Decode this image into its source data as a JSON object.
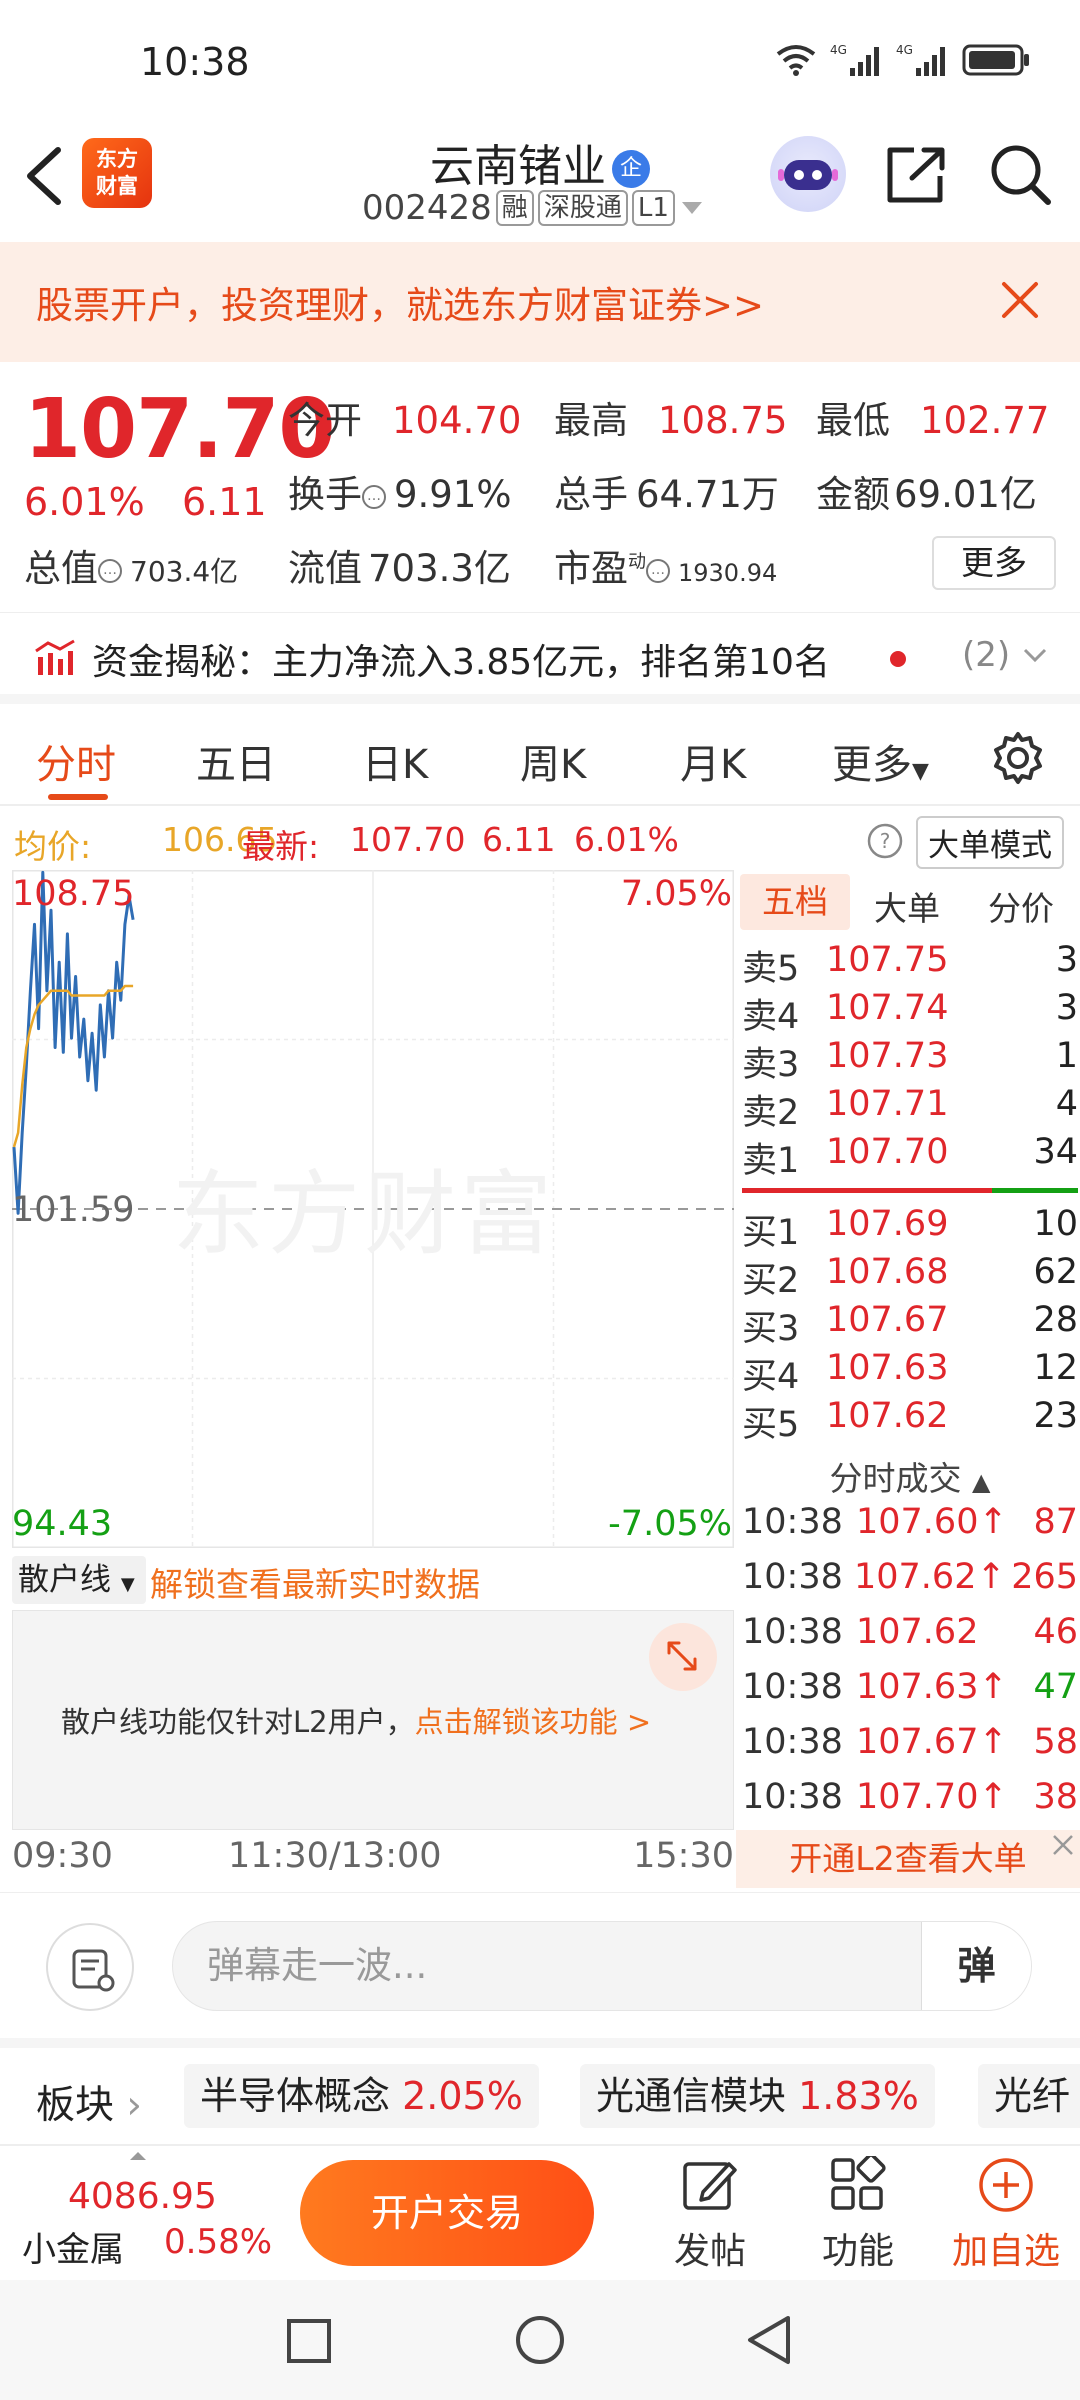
{
  "status": {
    "time": "10:38"
  },
  "header": {
    "logo_text": "东方\n财富",
    "stock_name": "云南锗业",
    "ent_badge": "企",
    "stock_code": "002428",
    "tags": [
      "融",
      "深股通",
      "L1"
    ]
  },
  "banner": {
    "text": "股票开户，投资理财，就选东方财富证券>>"
  },
  "quote": {
    "price": "107.70",
    "change_pct": "6.01%",
    "change": "6.11",
    "open_label": "今开",
    "open": "104.70",
    "high_label": "最高",
    "high": "108.75",
    "low_label": "最低",
    "low": "102.77",
    "turnover_label": "换手",
    "turnover": "9.91%",
    "volume_label": "总手",
    "volume": "64.71万",
    "amount_label": "金额",
    "amount": "69.01亿",
    "mktcap_label": "总值",
    "mktcap": "703.4亿",
    "float_label": "流值",
    "float": "703.3亿",
    "pe_label": "市盈",
    "pe_sup": "动",
    "pe": "1930.94",
    "more_label": "更多"
  },
  "fund": {
    "text": "资金揭秘：主力净流入3.85亿元，排名第10名",
    "count": "(2)"
  },
  "tabs": [
    "分时",
    "五日",
    "日K",
    "周K",
    "月K",
    "更多"
  ],
  "avg": {
    "avg_label": "均价:",
    "avg_value": "106.65",
    "latest_label": "最新:",
    "latest_value": "107.70",
    "latest_change": "6.11",
    "latest_pct": "6.01%",
    "mode_label": "大单模式"
  },
  "chart": {
    "top_price": "108.75",
    "top_pct": "7.05%",
    "mid_price": "101.59",
    "bottom_price": "94.43",
    "bottom_pct": "-7.05%",
    "watermark": "东方财富",
    "time_start": "09:30",
    "time_mid": "11:30/13:00",
    "time_end": "15:30"
  },
  "chart_data": {
    "type": "line",
    "ylim": [
      94.43,
      108.75
    ],
    "ylabel": "",
    "xlabel": "",
    "series": [
      {
        "values": [
          102.9,
          101.5,
          103.2,
          104.6,
          106.2,
          107.6,
          105.4,
          108.7,
          106.2,
          107.9,
          105.0,
          106.8,
          104.9,
          107.4,
          105.2,
          106.5,
          104.8,
          105.6,
          104.3,
          105.3,
          104.1,
          105.9,
          104.8,
          106.2,
          105.2,
          106.8,
          106.0,
          107.6,
          108.2,
          107.7
        ]
      },
      {
        "values": [
          102.9,
          103.2,
          104.2,
          105.0,
          105.4,
          105.7,
          105.9,
          106.0,
          106.1,
          106.2,
          106.2,
          106.2,
          106.2,
          106.2,
          106.1,
          106.1,
          106.1,
          106.1,
          106.1,
          106.1,
          106.1,
          106.1,
          106.1,
          106.2,
          106.2,
          106.2,
          106.2,
          106.3,
          106.3,
          106.3
        ]
      }
    ]
  },
  "book": {
    "tabs": [
      "五档",
      "大单",
      "分价"
    ],
    "asks": [
      {
        "side": "卖5",
        "price": "107.75",
        "qty": "3"
      },
      {
        "side": "卖4",
        "price": "107.74",
        "qty": "3"
      },
      {
        "side": "卖3",
        "price": "107.73",
        "qty": "1"
      },
      {
        "side": "卖2",
        "price": "107.71",
        "qty": "4"
      },
      {
        "side": "卖1",
        "price": "107.70",
        "qty": "34"
      }
    ],
    "bids": [
      {
        "side": "买1",
        "price": "107.69",
        "qty": "10"
      },
      {
        "side": "买2",
        "price": "107.68",
        "qty": "62"
      },
      {
        "side": "买3",
        "price": "107.67",
        "qty": "28"
      },
      {
        "side": "买4",
        "price": "107.63",
        "qty": "12"
      },
      {
        "side": "买5",
        "price": "107.62",
        "qty": "23"
      }
    ]
  },
  "trades": {
    "title": "分时成交",
    "rows": [
      {
        "time": "10:38",
        "price": "107.60↑",
        "qty": "87",
        "color": "#e0262b"
      },
      {
        "time": "10:38",
        "price": "107.62↑",
        "qty": "265",
        "color": "#e0262b"
      },
      {
        "time": "10:38",
        "price": "107.62",
        "qty": "46",
        "color": "#e0262b"
      },
      {
        "time": "10:38",
        "price": "107.63↑",
        "qty": "47",
        "color": "#14a014"
      },
      {
        "time": "10:38",
        "price": "107.67↑",
        "qty": "58",
        "color": "#e0262b"
      },
      {
        "time": "10:38",
        "price": "107.70↑",
        "qty": "38",
        "color": "#e0262b"
      }
    ],
    "l2_text": "开通L2查看大单"
  },
  "retail": {
    "select_label": "散户线",
    "unlock_link": "解锁查看最新实时数据",
    "msg": "散户线功能仅针对L2用户，",
    "msg_link": "点击解锁该功能 >"
  },
  "comment": {
    "placeholder": "弹幕走一波...",
    "send": "弹"
  },
  "sectors": {
    "label": "板块",
    "items": [
      {
        "name": "半导体概念",
        "pct": "2.05%"
      },
      {
        "name": "光通信模块",
        "pct": "1.83%"
      },
      {
        "name": "光纤",
        "pct": ""
      }
    ]
  },
  "toolbar": {
    "index_value": "4086.95",
    "index_name": "小金属",
    "index_pct": "0.58%",
    "trade_btn": "开户交易",
    "post": "发帖",
    "func": "功能",
    "add": "加自选"
  },
  "colors": {
    "up": "#e0262b",
    "down": "#14a014",
    "accent": "#e64a19",
    "price_line": "#2f6db5",
    "avg_line": "#e8a628"
  }
}
